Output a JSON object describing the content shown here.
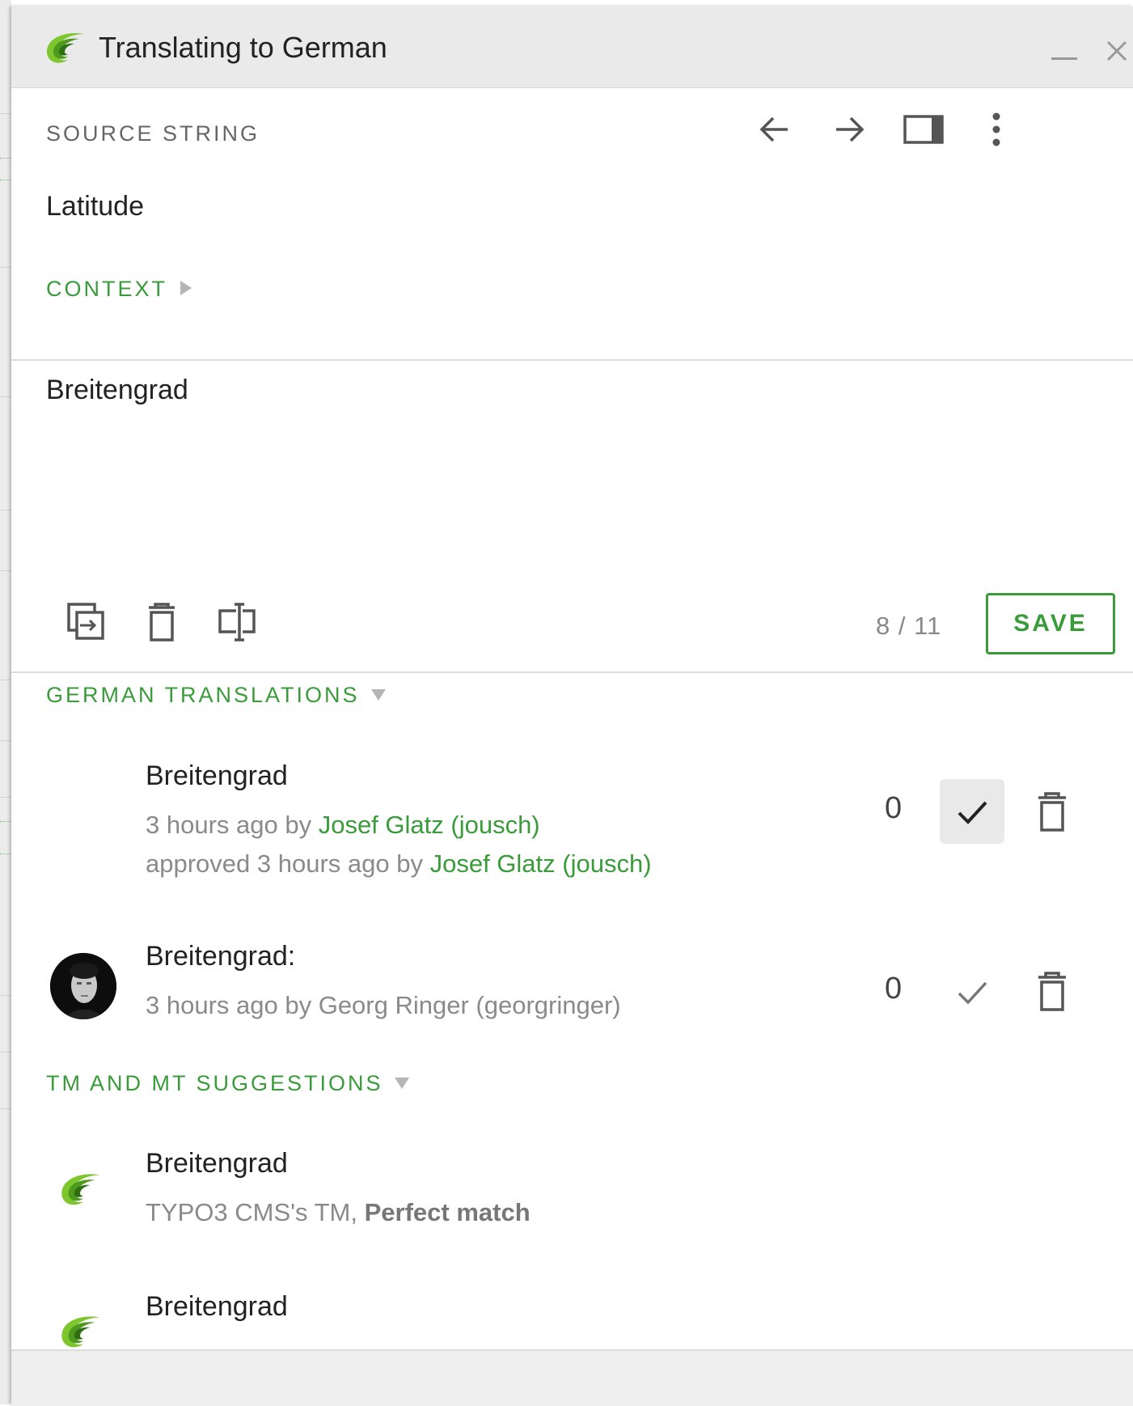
{
  "dialog": {
    "title": "Translating to German"
  },
  "source": {
    "label": "SOURCE STRING",
    "text": "Latitude",
    "context_label": "CONTEXT"
  },
  "editor": {
    "value": "Breitengrad",
    "char_count": "8 / 11",
    "save_label": "SAVE"
  },
  "translations": {
    "label": "GERMAN TRANSLATIONS",
    "items": [
      {
        "text": "Breitengrad",
        "meta_time": "3 hours ago by ",
        "meta_user": "Josef Glatz (jousch)",
        "approved_prefix": "approved 3 hours ago by ",
        "approved_user": "Josef Glatz (jousch)",
        "votes": "0",
        "approved": true
      },
      {
        "text": "Breitengrad:",
        "meta_time": "3 hours ago by ",
        "meta_user": "Georg Ringer (georgringer)",
        "votes": "0",
        "approved": false
      }
    ]
  },
  "suggestions": {
    "label": "TM AND MT SUGGESTIONS",
    "items": [
      {
        "text": "Breitengrad",
        "source": "TYPO3 CMS's TM, ",
        "quality": "Perfect match"
      },
      {
        "text": "Breitengrad"
      }
    ]
  },
  "icons": {
    "logo": "crowdin-logo-icon",
    "prev": "arrow-left-icon",
    "next": "arrow-right-icon",
    "layout": "sidebar-layout-icon",
    "more": "more-vert-icon",
    "copy_source": "copy-source-icon",
    "clear": "trash-icon",
    "resize": "text-cursor-icon"
  },
  "colors": {
    "accent": "#3a9b3a",
    "titlebar": "#eaeaea",
    "logo_green": "#7dc62d"
  }
}
